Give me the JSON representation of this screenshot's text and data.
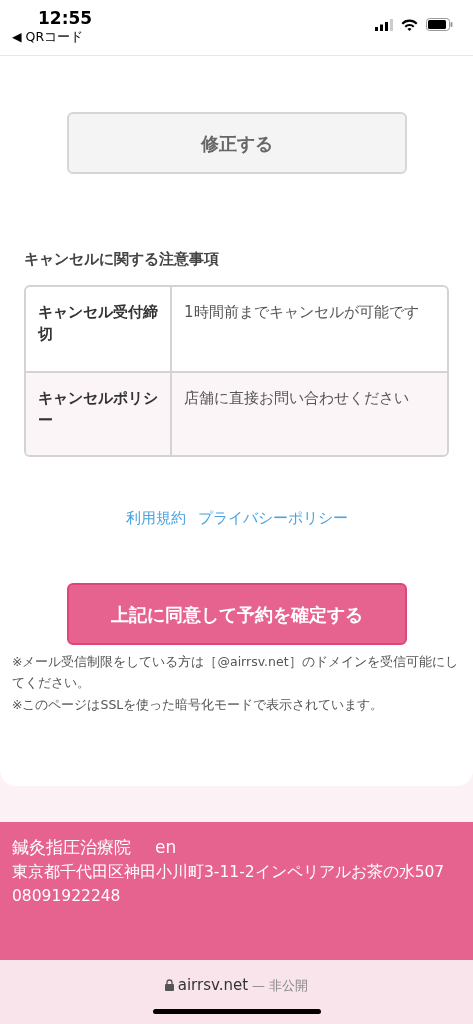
{
  "status_bar": {
    "time": "12:55",
    "back_app": "◀ QRコード"
  },
  "edit_button": "修正する",
  "cancel_section": {
    "title": "キャンセルに関する注意事項",
    "rows": [
      {
        "label": "キャンセル受付締切",
        "value": "1時間前までキャンセルが可能です"
      },
      {
        "label": "キャンセルポリシー",
        "value": "店舗に直接お問い合わせください"
      }
    ]
  },
  "links": [
    "利用規約",
    "プライバシーポリシー"
  ],
  "confirm_button": "上記に同意して予約を確定する",
  "notes": [
    "※メール受信制限をしている方は［@airrsv.net］のドメインを受信可能にしてください。",
    "※このページはSSLを使った暗号化モードで表示されています。"
  ],
  "footer": {
    "shop_name": "鍼灸指圧治療院",
    "language": "en",
    "address": "東京都千代田区神田小川町3-11-2インペリアルお茶の水507",
    "phone": "08091922248"
  },
  "browser_bar": {
    "domain": "airrsv.net",
    "mode": "— 非公開"
  }
}
